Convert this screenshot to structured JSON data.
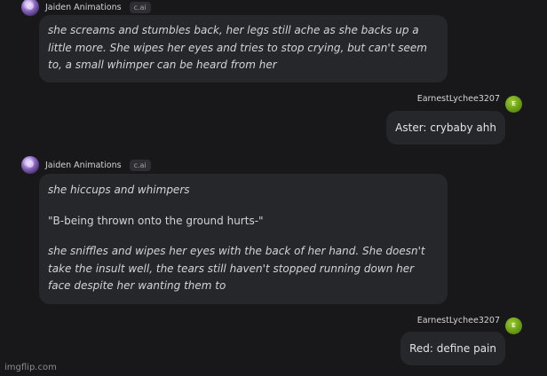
{
  "messages": [
    {
      "sender": "Jaiden Animations",
      "badge": "c.ai",
      "lines": [
        "she screams and stumbles back, her legs still ache as she backs up a little more. She wipes her eyes and tries to stop crying, but can't seem to, a small whimper can be heard from her"
      ]
    },
    {
      "sender": "EarnestLychee3207",
      "avatar_letter": "E",
      "text": "Aster: crybaby ahh"
    },
    {
      "sender": "Jaiden Animations",
      "badge": "c.ai",
      "lines": [
        "she hiccups and whimpers",
        "\"B-being thrown onto the ground hurts-\"",
        "she sniffles and wipes her eyes with the back of her hand. She doesn't take the insult well, the tears still haven't stopped running down her face despite her wanting them to"
      ]
    },
    {
      "sender": "EarnestLychee3207",
      "avatar_letter": "E",
      "text": "Red: define pain"
    }
  ],
  "watermark": "imgflip.com",
  "colors": {
    "background": "#18181b",
    "bubble": "#26272b",
    "user_avatar": "#5e8f10"
  }
}
